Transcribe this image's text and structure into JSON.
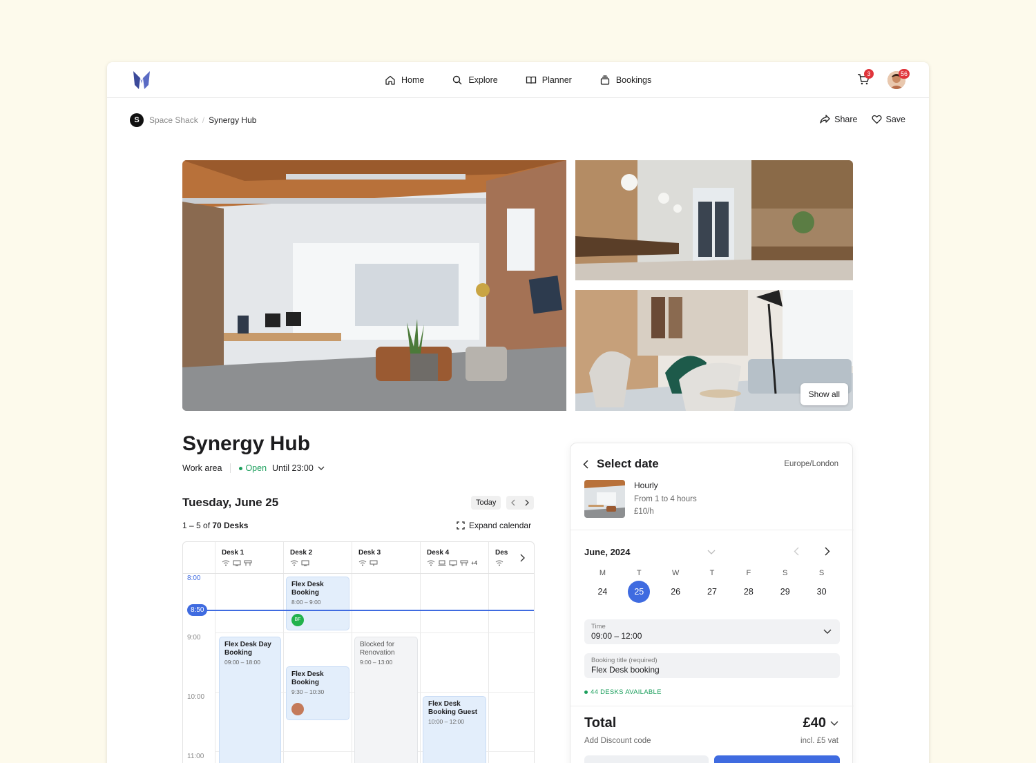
{
  "nav": {
    "items": [
      {
        "label": "Home",
        "icon": "home-icon"
      },
      {
        "label": "Explore",
        "icon": "search-icon"
      },
      {
        "label": "Planner",
        "icon": "book-icon"
      },
      {
        "label": "Bookings",
        "icon": "stack-icon"
      }
    ],
    "cart_count": "3",
    "notifications_count": "56"
  },
  "breadcrumb": {
    "logo_glyph": "S",
    "parent": "Space Shack",
    "separator": "/",
    "current": "Synergy Hub"
  },
  "actions": {
    "share": "Share",
    "save": "Save"
  },
  "gallery": {
    "show_all": "Show all"
  },
  "venue": {
    "title": "Synergy Hub",
    "type": "Work area",
    "status": "Open",
    "until": "Until 23:00"
  },
  "calendar": {
    "day_title": "Tuesday, June 25",
    "today_label": "Today",
    "count_range": "1 – 5 of ",
    "count_total": "70 Desks",
    "expand_label": "Expand calendar",
    "desks": [
      "Desk 1",
      "Desk 2",
      "Desk 3",
      "Desk 4",
      "Des"
    ],
    "extra_amenities": "+4",
    "hours": [
      "8:00",
      "9:00",
      "10:00",
      "11:00"
    ],
    "now": "8:50",
    "events": [
      {
        "title": "Flex Desk Booking",
        "time": "8:00 – 9:00",
        "avatar": "BF"
      },
      {
        "title": "Flex Desk Day Booking",
        "time": "09:00 – 18:00"
      },
      {
        "title": "Blocked for Renovation",
        "time": "9:00 – 13:00"
      },
      {
        "title": "Flex Desk Booking",
        "time": "9:30 – 10:30"
      },
      {
        "title": "Flex Desk Booking Guest",
        "time": "10:00 – 12:00"
      }
    ]
  },
  "booking": {
    "heading": "Select date",
    "timezone": "Europe/London",
    "rate_type": "Hourly",
    "duration": "From 1 to 4 hours",
    "rate": "£10/h",
    "month": "June, 2024",
    "weekdays": [
      "M",
      "T",
      "W",
      "T",
      "F",
      "S",
      "S"
    ],
    "days": [
      "24",
      "25",
      "26",
      "27",
      "28",
      "29",
      "30"
    ],
    "selected_day": "25",
    "time_label": "Time",
    "time_value": "09:00 – 12:00",
    "title_label": "Booking title (required)",
    "title_value": "Flex Desk booking",
    "availability": "44 DESKS AVAILABLE",
    "total_label": "Total",
    "total_value": "£40",
    "discount": "Add Discount code",
    "vat": "incl. £5 vat"
  },
  "colors": {
    "accent": "#3f6be0",
    "success": "#1a9e5b",
    "badge": "#e0353b",
    "page_bg": "#fdfaec"
  }
}
